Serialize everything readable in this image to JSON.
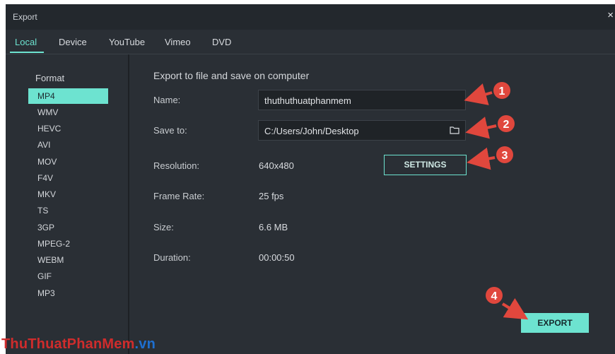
{
  "window": {
    "title": "Export",
    "close_symbol": "×"
  },
  "tabs": [
    {
      "label": "Local",
      "active": true
    },
    {
      "label": "Device",
      "active": false
    },
    {
      "label": "YouTube",
      "active": false
    },
    {
      "label": "Vimeo",
      "active": false
    },
    {
      "label": "DVD",
      "active": false
    }
  ],
  "sidebar": {
    "format_label": "Format",
    "formats": [
      "MP4",
      "WMV",
      "HEVC",
      "AVI",
      "MOV",
      "F4V",
      "MKV",
      "TS",
      "3GP",
      "MPEG-2",
      "WEBM",
      "GIF",
      "MP3"
    ],
    "selected": "MP4"
  },
  "main": {
    "heading": "Export to file and save on computer",
    "name_label": "Name:",
    "name_value": "thuthuthuatphanmem",
    "save_label": "Save to:",
    "save_value": "C:/Users/John/Desktop",
    "resolution_label": "Resolution:",
    "resolution_value": "640x480",
    "settings_button": "SETTINGS",
    "framerate_label": "Frame Rate:",
    "framerate_value": "25 fps",
    "size_label": "Size:",
    "size_value": "6.6 MB",
    "duration_label": "Duration:",
    "duration_value": "00:00:50",
    "export_button": "EXPORT"
  },
  "annotations": [
    "1",
    "2",
    "3",
    "4"
  ],
  "watermark": {
    "part1": "ThuThuatPhanMem",
    "part2": ".vn"
  },
  "colors": {
    "accent": "#6de3d0",
    "window_bg": "#2a2f35",
    "annotation": "#e0473d"
  }
}
